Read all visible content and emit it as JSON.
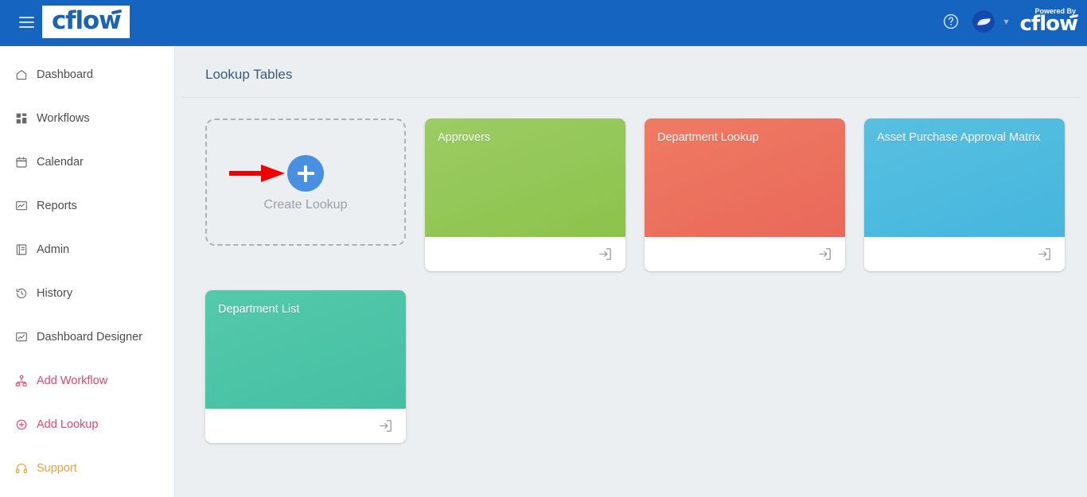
{
  "header": {
    "menu_icon": "hamburger-menu-icon",
    "brand": "cflow",
    "help_icon": "help-circle-icon",
    "avatar_icon": "user-avatar",
    "caret_icon": "chevron-down-icon",
    "powered_by_text": "Powered By",
    "powered_by_brand": "cflow",
    "background_color": "#1565c0"
  },
  "sidebar": {
    "items": [
      {
        "label": "Dashboard",
        "icon": "home-icon",
        "color": "default"
      },
      {
        "label": "Workflows",
        "icon": "grid-squares-icon",
        "color": "default"
      },
      {
        "label": "Calendar",
        "icon": "calendar-icon",
        "color": "default"
      },
      {
        "label": "Reports",
        "icon": "report-chart-icon",
        "color": "default"
      },
      {
        "label": "Admin",
        "icon": "book-admin-icon",
        "color": "default"
      },
      {
        "label": "History",
        "icon": "clock-history-icon",
        "color": "default"
      },
      {
        "label": "Dashboard Designer",
        "icon": "dashboard-designer-icon",
        "color": "default"
      },
      {
        "label": "Add Workflow",
        "icon": "add-workflow-icon",
        "color": "#e0476b"
      },
      {
        "label": "Add Lookup",
        "icon": "add-lookup-icon",
        "color": "#e0476b"
      },
      {
        "label": "Support",
        "icon": "headset-support-icon",
        "color": "#e8a33d"
      }
    ]
  },
  "main": {
    "page_title": "Lookup Tables",
    "create_tile": {
      "label": "Create Lookup",
      "plus_icon": "plus-circle-icon",
      "annotation_icon": "red-arrow-annotation",
      "plus_color": "#4a90e2",
      "arrow_color": "#f00000"
    },
    "cards": [
      {
        "name": "Approvers",
        "color_from": "#9ccc65",
        "color_to": "#8bc34a",
        "open_icon": "open-in-icon"
      },
      {
        "name": "Department Lookup",
        "color_from": "#ef7b63",
        "color_to": "#e9685a",
        "open_icon": "open-in-icon"
      },
      {
        "name": "Asset Purchase Approval Matrix",
        "color_from": "#58c0e0",
        "color_to": "#45b6dd",
        "open_icon": "open-in-icon"
      },
      {
        "name": "Department List",
        "color_from": "#55c9ab",
        "color_to": "#45bfa3",
        "open_icon": "open-in-icon"
      }
    ]
  }
}
